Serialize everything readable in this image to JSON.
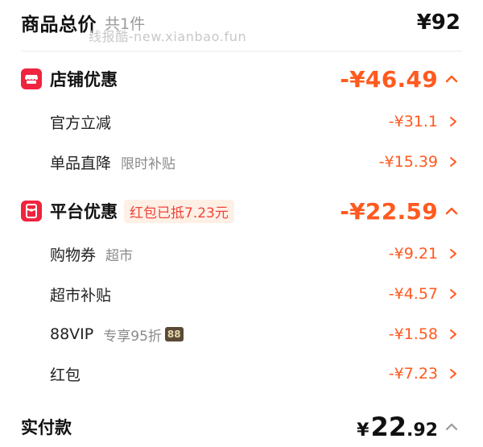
{
  "header": {
    "title": "商品总价",
    "count": "共1件",
    "total": "¥92",
    "watermark": "线报酷-new.xianbao.fun"
  },
  "store_discount": {
    "title": "店铺优惠",
    "amount": "-¥46.49",
    "items": [
      {
        "label": "官方立减",
        "note": "",
        "amount": "-¥31.1"
      },
      {
        "label": "单品直降",
        "note": "限时补贴",
        "amount": "-¥15.39"
      }
    ]
  },
  "platform_discount": {
    "title": "平台优惠",
    "tag": "红包已抵7.23元",
    "amount": "-¥22.59",
    "items": [
      {
        "label": "购物券",
        "note": "超市",
        "amount": "-¥9.21"
      },
      {
        "label": "超市补贴",
        "note": "",
        "amount": "-¥4.57"
      },
      {
        "label": "88VIP",
        "note": "专享95折",
        "badge": "88",
        "amount": "-¥1.58"
      },
      {
        "label": "红包",
        "note": "",
        "amount": "-¥7.23"
      }
    ]
  },
  "footer": {
    "label": "实付款",
    "currency": "¥",
    "integer": "22",
    "decimal": ".92"
  },
  "colors": {
    "accent": "#ff5a1f",
    "icon_red": "#f0243e",
    "tag_bg": "#fff0e6"
  },
  "icons": {
    "store": "shop-icon",
    "platform": "redpacket-icon",
    "expand": "chevron-up-icon",
    "detail": "chevron-right-icon"
  }
}
